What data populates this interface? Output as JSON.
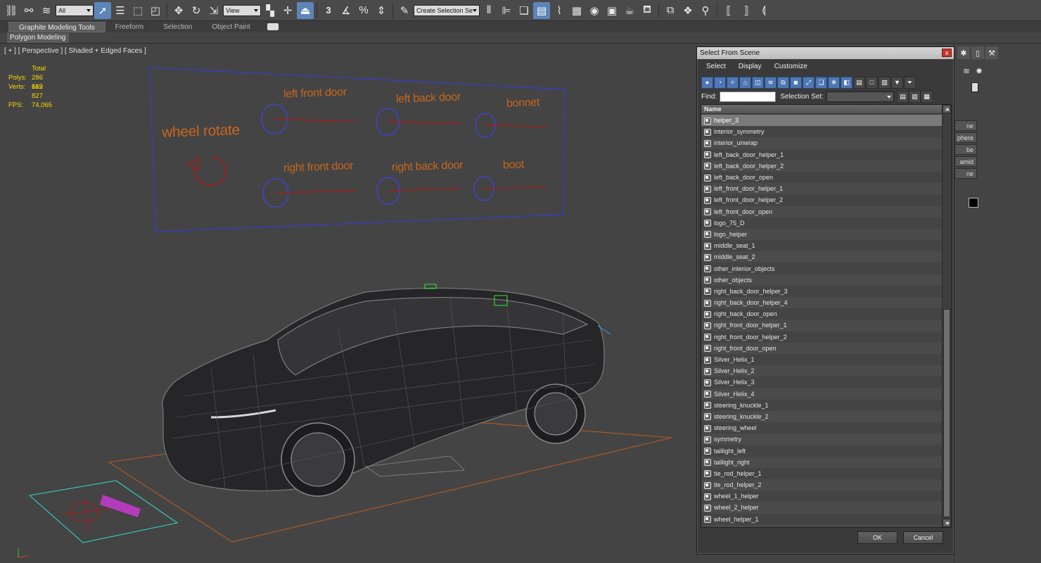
{
  "toolbar": {
    "filter_value": "All",
    "ref_coord_value": "View",
    "snap_label": "3",
    "create_selection_set": "Create Selection Se"
  },
  "ribbon": {
    "tabs": [
      {
        "label": "Graphite Modeling Tools",
        "active": true
      },
      {
        "label": "Freeform",
        "active": false
      },
      {
        "label": "Selection",
        "active": false
      },
      {
        "label": "Object Paint",
        "active": false
      }
    ],
    "sub_tab": "Polygon Modeling"
  },
  "viewport": {
    "label": "[ + ] [ Perspective ] [ Shaded + Edged Faces ]",
    "stats": {
      "total_label": "Total",
      "polys_label": "Polys:",
      "polys_value": "286 619",
      "verts_label": "Verts:",
      "verts_value": "162 827",
      "fps_label": "FPS:",
      "fps_value": "74,065"
    },
    "helper_labels": {
      "wheel_rotate": "wheel rotate",
      "left_front_door": "left front door",
      "left_back_door": "left back door",
      "bonnet": "bonnet",
      "right_front_door": "right front door",
      "right_back_door": "right back door",
      "boot": "boot"
    },
    "colors": {
      "background": "#444444",
      "helper_frame": "#3a3ad0",
      "helper_text": "#c8651e",
      "slider_line": "#b01818",
      "stats_text": "#ffd800"
    }
  },
  "command_panel": {
    "boxes": [
      "ne",
      "phere",
      "be",
      "amid",
      "ne"
    ]
  },
  "dialog": {
    "title": "Select From Scene",
    "close_glyph": "x",
    "menus": [
      "Select",
      "Display",
      "Customize"
    ],
    "find_label": "Find:",
    "find_value": "",
    "selection_set_label": "Selection Set:",
    "column_header": "Name",
    "ok_label": "OK",
    "cancel_label": "Cancel",
    "items": [
      "helper_3",
      "interior_symmetry",
      "interior_unwrap",
      "left_back_door_helper_1",
      "left_back_door_helper_2",
      "left_back_door_open",
      "left_front_door_helper_1",
      "left_front_door_helper_2",
      "left_front_door_open",
      "logo_75_D",
      "logo_helper",
      "middle_seat_1",
      "middle_seat_2",
      "other_interior_objects",
      "other_objects",
      "right_back_door_helper_3",
      "right_back_door_helper_4",
      "right_back_door_open",
      "right_front_door_helper_1",
      "right_front_door_helper_2",
      "right_front_door_open",
      "Silver_Helix_1",
      "Silver_Helix_2",
      "Silver_Helix_3",
      "Silver_Helix_4",
      "steering_knuckle_1",
      "steering_knuckle_2",
      "steering_wheel",
      "symmetry",
      "taillight_left",
      "taillight_right",
      "tie_rod_helper_1",
      "tie_rod_helper_2",
      "wheel_1_helper",
      "wheel_2_helper",
      "wheel_helper_1"
    ],
    "selected_item": "helper_3"
  }
}
